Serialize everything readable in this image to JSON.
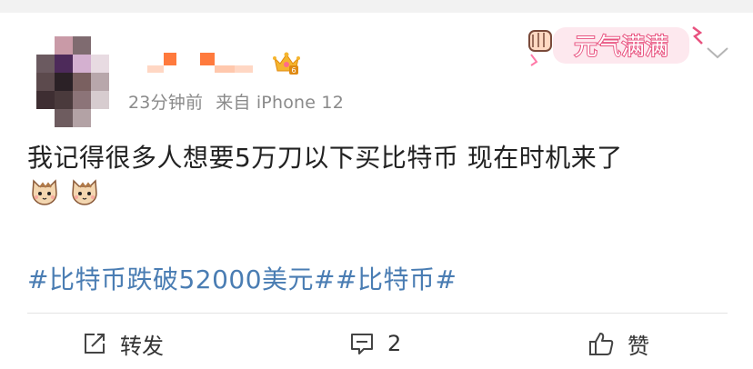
{
  "post": {
    "meta": {
      "time": "23分钟前",
      "source": "来自 iPhone 12"
    },
    "badge_letter": "6",
    "sticker_text": "元气满满",
    "content": "我记得很多人想要5万刀以下买比特币 现在时机来了",
    "emoji": [
      {
        "icon": "cat-face-icon"
      },
      {
        "icon": "cat-face-icon"
      }
    ],
    "hashtags": "#比特币跌破52000美元##比特币#"
  },
  "actions": {
    "repost_label": "转发",
    "comment_count": "2",
    "like_label": "赞"
  },
  "colors": {
    "hashtag": "#4a7db3",
    "meta": "#8a8a8a",
    "text": "#222222",
    "name_blocks": "#ff7a3d"
  }
}
